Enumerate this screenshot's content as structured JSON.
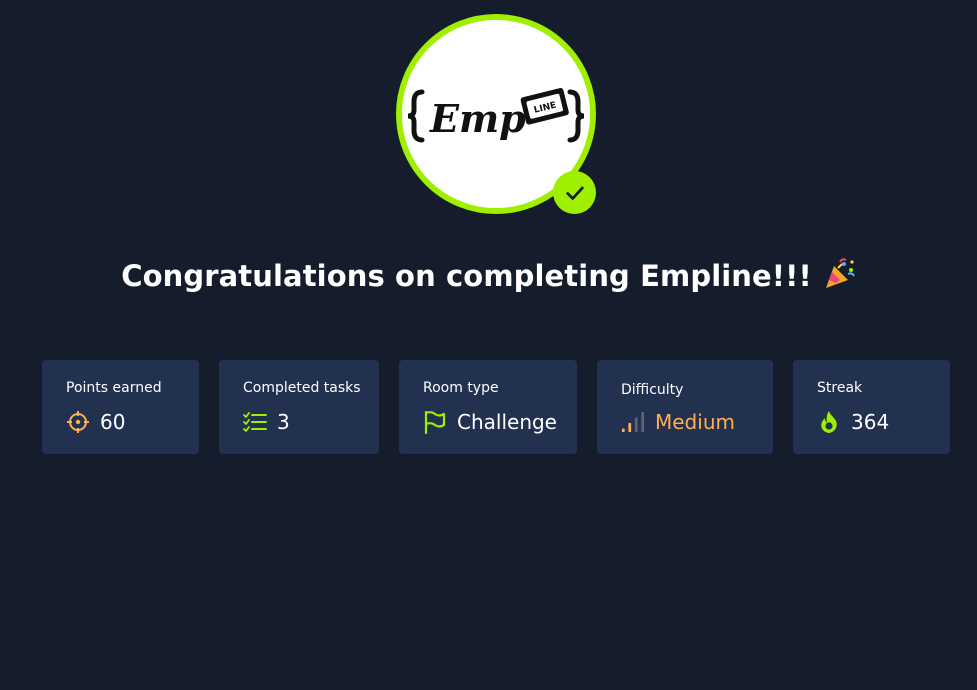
{
  "room": {
    "logo_alt": "{ Emp LINE }",
    "completed_badge": "completed-check",
    "headline": "Congratulations on completing Empline!!!",
    "headline_emoji": "party-popper-icon"
  },
  "stats": [
    {
      "label": "Points earned",
      "value": "60",
      "icon": "target-icon",
      "accent": "#ffaf4f"
    },
    {
      "label": "Completed tasks",
      "value": "3",
      "icon": "checklist-icon",
      "accent": "#9fef00"
    },
    {
      "label": "Room type",
      "value": "Challenge",
      "icon": "flag-icon",
      "accent": "#9fef00"
    },
    {
      "label": "Difficulty",
      "value": "Medium",
      "icon": "signal-bars-icon",
      "accent": "#ffaf4f"
    },
    {
      "label": "Streak",
      "value": "364",
      "icon": "flame-icon",
      "accent": "#9fef00"
    }
  ],
  "colors": {
    "background": "#151c2b",
    "card": "#21314f",
    "accent_green": "#9fef00",
    "accent_orange": "#ffaf4f"
  }
}
